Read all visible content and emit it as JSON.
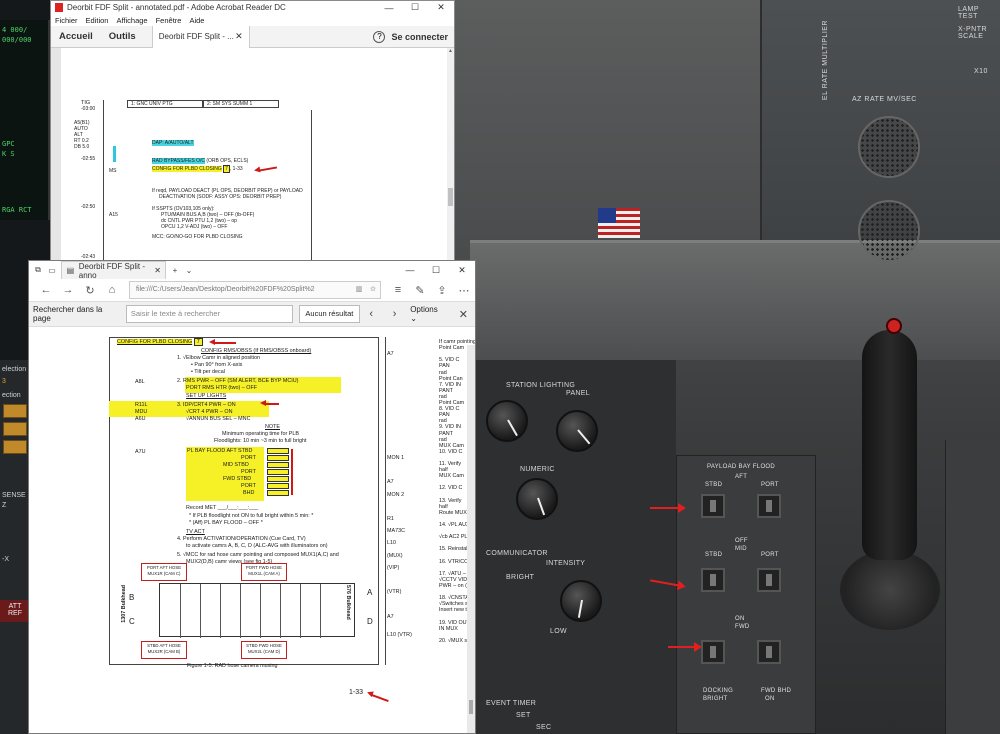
{
  "acrobat": {
    "title": "Deorbit FDF Split - annotated.pdf - Adobe Acrobat Reader DC",
    "menu": [
      "Fichier",
      "Edition",
      "Affichage",
      "Fenêtre",
      "Aide"
    ],
    "tabs": {
      "home": "Accueil",
      "tools": "Outils",
      "doc": "Deorbit FDF Split - ..."
    },
    "sign_in": "Se connecter",
    "page": {
      "tig": "TIG",
      "times": [
        "-03:00",
        "-02:55",
        "-02:50",
        "-02:43"
      ],
      "header_left": "1: GNC UNIV PTG",
      "header_right": "2: SM SYS SUMM 1",
      "a5_block": [
        "A5(B1)",
        "AUTO",
        "ALT",
        "RT  0.2",
        "DB  5.0"
      ],
      "station_ms": "MS",
      "station_a15": "A15",
      "lines": {
        "dap": "DAP:  A/AUTO/ALT",
        "rad": "RAD BYPASS/FES O/C",
        "rad_suffix": " (ORB OPS, ECLS)",
        "config": "CONFIG FOR PLBD CLOSING",
        "config_ref": "7",
        "config_page": ", 1-33",
        "if_reqd": "If reqd, PAYLOAD DEACT (PL OPS, DEORBIT PREP) or PAYLOAD",
        "deact": "DEACTIVATION (SODF: ASSY OPS: DEORBIT PREP)",
        "if_ssp": "If SSPTS (OV103,105 only):",
        "ptu": "PTU/MAIN BUS A,B (two) – OFF (tb-OFF)",
        "dc": "dc CNTL PWR PTU 1,2 (two) – op",
        "opcu": "OPCU 1,2 V-ADJ (two) – OFF",
        "mcc": "MCC:  GO/NO-GO FOR PLBD CLOSING"
      }
    }
  },
  "edge": {
    "tab_title": "Deorbit FDF Split - anno",
    "url": "file:///C:/Users/Jean/Desktop/Deorbit%20FDF%20Split%2",
    "find": {
      "label": "Rechercher dans la page",
      "placeholder": "Saisir le texte à rechercher",
      "result": "Aucun résultat",
      "options": "Options"
    },
    "page": {
      "config_title": "CONFIG FOR PLBD CLOSING",
      "config_ref": "7",
      "config_rms": "CONFIG RMS/OBSS",
      "config_rms_suffix": " (If RMS/OBSS onboard)",
      "steps": [
        "1.  √Elbow Camr in aligned position",
        "•  Pan 90° from X-axis",
        "•  Tilt per decal",
        "2.  RMS PWR – OFF (SM ALERT, BCE BYP MCIU)",
        "PORT RMS HTR (two) – OFF",
        "SET UP LIGHTS",
        "3.  IDP/CRT4 PWR        – ON",
        "√CRT 4 PWR              – ON",
        "√ANNUN BUS SEL – MNC",
        "NOTE",
        "Minimum operating time for PLB",
        "Floodlights:  10 min ~3 min to full bright",
        "PL BAY FLOOD AFT STBD",
        "PORT",
        "MID STBD",
        "PORT",
        "FWD STBD",
        "PORT",
        "BHD",
        "Record MET ___/___:___:___",
        "* If PLB floodlight not ON to full bright within 5 min: *",
        "* (Aff) PL BAY FLOOD – OFF                          *",
        "TV ACT",
        "4.  Perform ACTIVATION/OPERATION (Cue Card, TV)",
        "to activate camrs A, B, C, D (ALC-AVG with illuminators on)",
        "5.  √MCC for rad hose camr pointing and composed MUX1(A,C) and",
        "MUX2(D,B) camr views (see fig 1-5)"
      ],
      "stations": [
        "A8L",
        "R11L",
        "MDU",
        "A6U",
        "A7U"
      ],
      "cams": {
        "port_aft": "PORT AFT HOSE MUX1R (CAM C)",
        "port_fwd": "PORT FWD HOSE MUX1L (CAM A)",
        "stbd_aft": "STBD AFT HOSE MUX2R (CAM B)",
        "stbd_fwd": "STBD FWD HOSE MUX2L (CAM D)"
      },
      "bulkhead_left": "1307 Bulkhead",
      "bulkhead_right": "576 Bulkhead",
      "letters": [
        "A",
        "B",
        "C",
        "D"
      ],
      "figure": "Figure 1-5.  RAD hose camera muxing",
      "page_number": "1-33",
      "right_col": [
        "If camr pointing",
        "Point Cam",
        "A7",
        "5.  VID C",
        "PAN",
        "rad",
        "Point Can",
        "7.  VID IN",
        "PANT",
        "rad",
        "Point Cam",
        "8.  VID C",
        "PAN",
        "rad",
        "9.  VID IN",
        "PANT",
        "rad",
        "MUX Cam",
        "10. VID C",
        "MON 1",
        "11. Verify",
        "half",
        "MUX Cam",
        "A7",
        "12. VID C",
        "MON 2",
        "13. Verify",
        "half",
        "Route MUX",
        "R1",
        "14. √PL AUX – O",
        "MA73C",
        "√cb AC2 PL 3",
        "L10",
        "15. Reinstall VIP",
        "(MUX)",
        "16. VTR/CC PWI",
        "(VIP)",
        "17. √ATU – REC",
        "√CCTV VID I",
        "PWR – on (L",
        "(VTR)",
        "18. √CNSTANDE",
        "√Switches se",
        "Insert new ta",
        "A7",
        "19. VID OUT DT",
        "IN MUX",
        "L10 (VTR)",
        "20. √MUX scene"
      ]
    }
  },
  "sim": {
    "left_gauges": [
      "4  000/",
      "000/000",
      "GPC",
      "K S",
      "RGA  RCT"
    ],
    "left_labels": [
      "election",
      "3",
      "ection",
      "S",
      "S",
      "S",
      "SENSE",
      "Z",
      "-X",
      "ATT",
      "REF"
    ],
    "right_top": [
      "EL RATE MULTIPLIER",
      "AZ RATE MV/SEC",
      "LAMP TEST",
      "X-PNTR SCALE",
      "X10"
    ],
    "console": [
      "STATION LIGHTING",
      "PANEL",
      "NUMERIC",
      "INTENSITY",
      "BRIGHT",
      "LOW",
      "OFF",
      "BRT",
      "COMMUNICATOR"
    ],
    "pbay": [
      "PAYLOAD BAY FLOOD",
      "AFT",
      "STBD",
      "PORT",
      "OFF",
      "MID",
      "STBD",
      "PORT",
      "ON",
      "FWD",
      "DOCKING",
      "FWD BHD",
      "BRIGHT",
      "ON"
    ],
    "event": [
      "EVENT TIMER",
      "SET",
      "SEC"
    ],
    "colors": {
      "highlight_yellow": "#f5f126",
      "highlight_cyan": "#49d5e0",
      "annotation_red": "#d01818"
    }
  }
}
